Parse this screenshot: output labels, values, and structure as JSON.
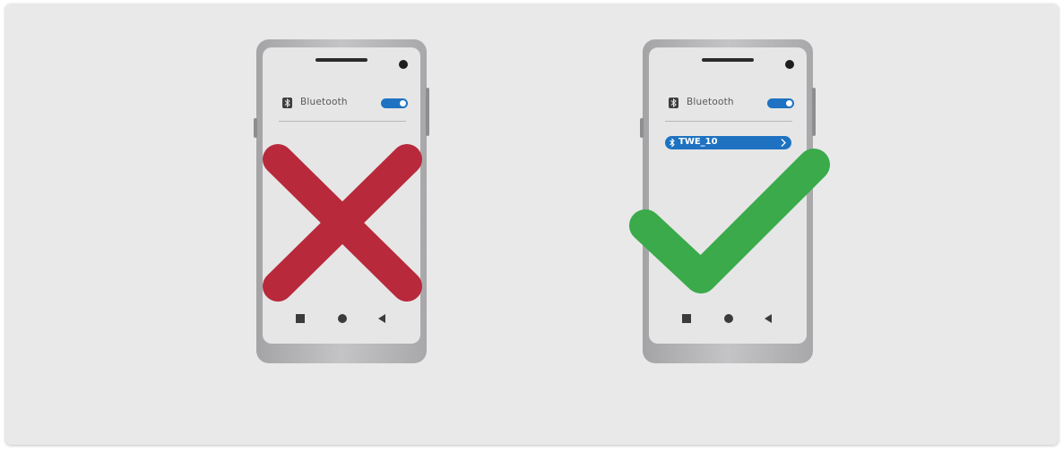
{
  "panels": [
    {
      "id": "not-connected",
      "bluetooth_label": "Bluetooth",
      "bluetooth_toggle_on": true,
      "device": null,
      "verdict": "wrong",
      "verdict_color": "#b8293b"
    },
    {
      "id": "connected",
      "bluetooth_label": "Bluetooth",
      "bluetooth_toggle_on": true,
      "device": {
        "name": "TWE_10",
        "icon": "bluetooth-icon",
        "action_icon": "chevron-right-icon"
      },
      "verdict": "correct",
      "verdict_color": "#3aaa4a"
    }
  ],
  "colors": {
    "background": "#e9e9ea",
    "accent_blue": "#1e72c1",
    "phone_body": "#b4b4b6",
    "screen": "#e6e6e6"
  },
  "nav_icons": [
    "recent-apps-square-icon",
    "home-circle-icon",
    "back-triangle-icon"
  ]
}
